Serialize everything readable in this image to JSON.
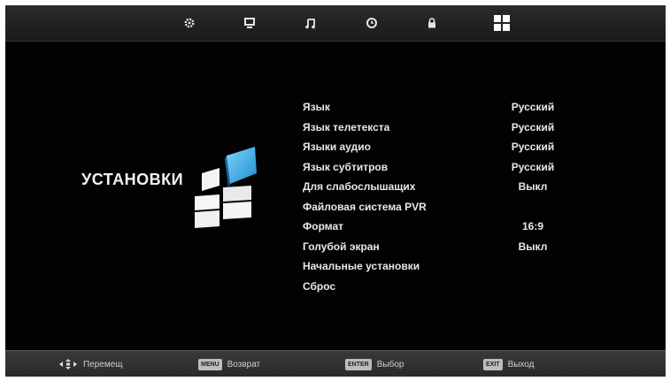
{
  "topbar": {
    "tabs": [
      {
        "icon": "gear-icon",
        "name": "tab-picture"
      },
      {
        "icon": "monitor-icon",
        "name": "tab-screen"
      },
      {
        "icon": "music-note-icon",
        "name": "tab-sound"
      },
      {
        "icon": "clock-icon",
        "name": "tab-time"
      },
      {
        "icon": "lock-icon",
        "name": "tab-lock"
      },
      {
        "icon": "grid-icon",
        "name": "tab-setup",
        "active": true
      }
    ]
  },
  "page": {
    "title": "УСТАНОВКИ",
    "logo_icon": "setup-cubes-icon"
  },
  "menu": {
    "items": [
      {
        "label": "Язык",
        "value": "Русский"
      },
      {
        "label": "Язык телетекста",
        "value": "Русский"
      },
      {
        "label": "Языки аудио",
        "value": "Русский"
      },
      {
        "label": "Язык субтитров",
        "value": "Русский"
      },
      {
        "label": "Для слабослышащих",
        "value": "Выкл"
      },
      {
        "label": "Файловая система PVR",
        "value": ""
      },
      {
        "label": "Формат",
        "value": "16:9"
      },
      {
        "label": "Голубой экран",
        "value": "Выкл"
      },
      {
        "label": "Начальные установки",
        "value": ""
      },
      {
        "label": "Сброс",
        "value": ""
      }
    ]
  },
  "footer": {
    "move": {
      "icon": "arrows-icon",
      "label": "Перемещ"
    },
    "back": {
      "key": "MENU",
      "label": "Возврат"
    },
    "select": {
      "key": "ENTER",
      "label": "Выбор"
    },
    "exit": {
      "key": "EXIT",
      "label": "Выход"
    }
  },
  "colors": {
    "accent": "#2a9fd8",
    "background": "#020202",
    "text": "#e8e8e8"
  }
}
